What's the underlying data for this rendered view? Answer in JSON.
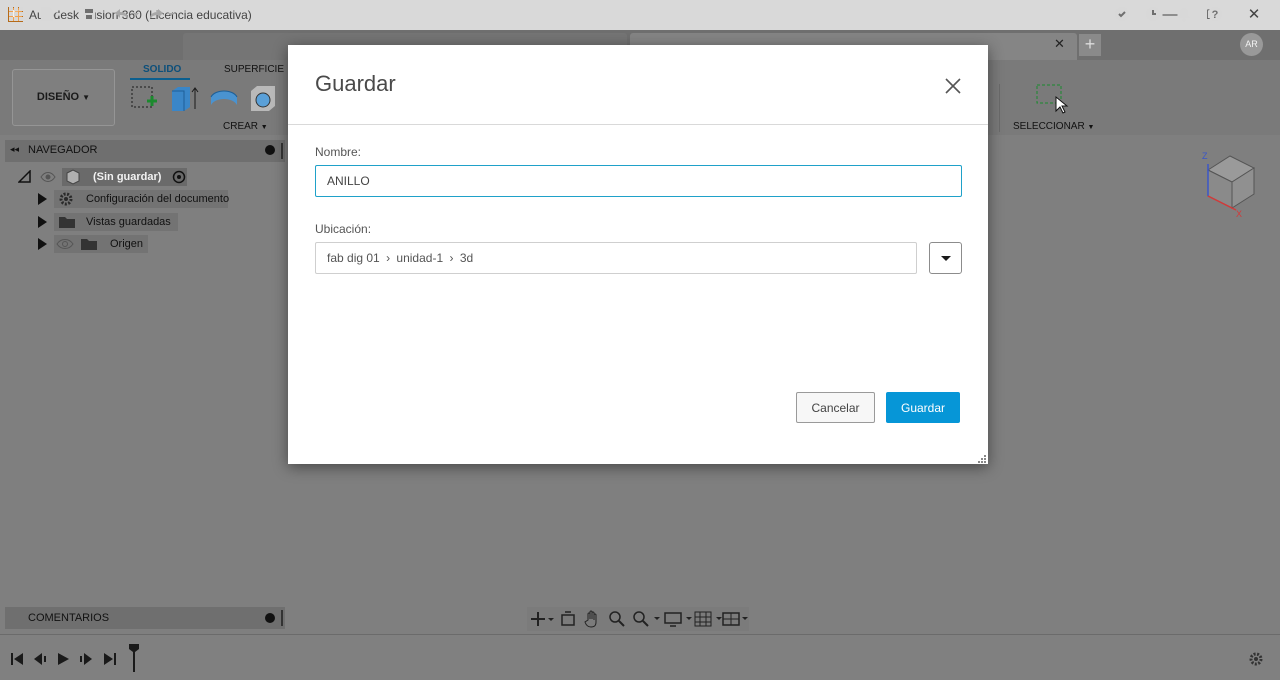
{
  "window": {
    "app_letter": "F",
    "title": "Autodesk Fusion 360 (Licencia educativa)",
    "minimize": "—",
    "maximize": "☐",
    "close": "✕"
  },
  "toolbar": {
    "tab_close": "✕",
    "new_tab": "+",
    "user_initials": "AR"
  },
  "ribbon": {
    "workspace": "DISEÑO",
    "tabs": [
      "SOLIDO",
      "SUPERFICIE"
    ],
    "create_label": "CREAR",
    "select_label": "SELECCIONAR"
  },
  "browser": {
    "title": "NAVEGADOR",
    "root": "(Sin guardar)",
    "items": [
      "Configuración del documento",
      "Vistas guardadas",
      "Origen"
    ]
  },
  "comments": {
    "title": "COMENTARIOS"
  },
  "viewcube": {
    "axis_z": "Z",
    "axis_x": "X"
  },
  "dialog": {
    "title": "Guardar",
    "name_label": "Nombre:",
    "name_value": "ANILLO",
    "location_label": "Ubicación:",
    "location_path": [
      "fab dig 01",
      "unidad-1",
      "3d"
    ],
    "path_separator": "›",
    "cancel_label": "Cancelar",
    "save_label": "Guardar"
  },
  "colors": {
    "accent": "#0696d7",
    "input_focus": "#1fa1c9",
    "background_dim": "#7f7f7f"
  }
}
